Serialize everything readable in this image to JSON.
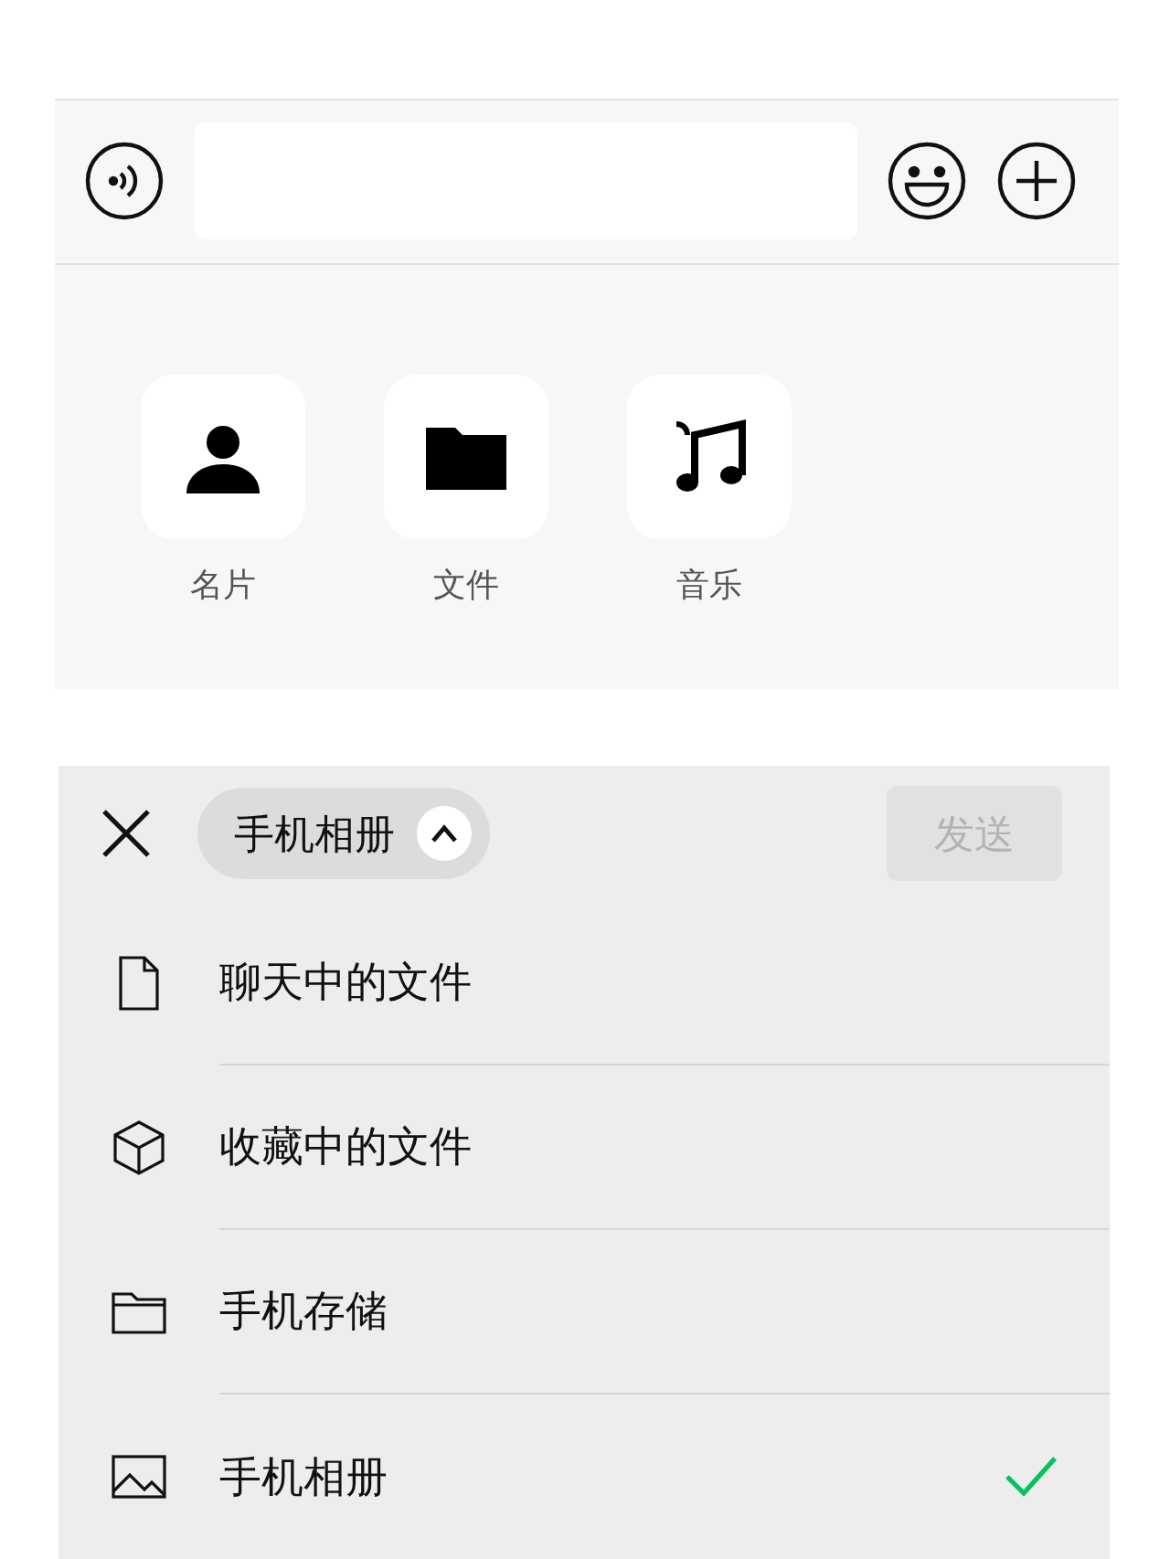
{
  "apps": [
    {
      "kind": "contact",
      "label": "名片"
    },
    {
      "kind": "folder",
      "label": "文件"
    },
    {
      "kind": "music",
      "label": "音乐"
    }
  ],
  "picker": {
    "source": "手机相册",
    "expanded": true,
    "send": {
      "label": "发送",
      "disabled": true
    },
    "items": [
      {
        "kind": "file",
        "label": "聊天中的文件",
        "selected": false
      },
      {
        "kind": "cube",
        "label": "收藏中的文件",
        "selected": false
      },
      {
        "kind": "folder",
        "label": "手机存储",
        "selected": false
      },
      {
        "kind": "image",
        "label": "手机相册",
        "selected": true
      }
    ]
  }
}
